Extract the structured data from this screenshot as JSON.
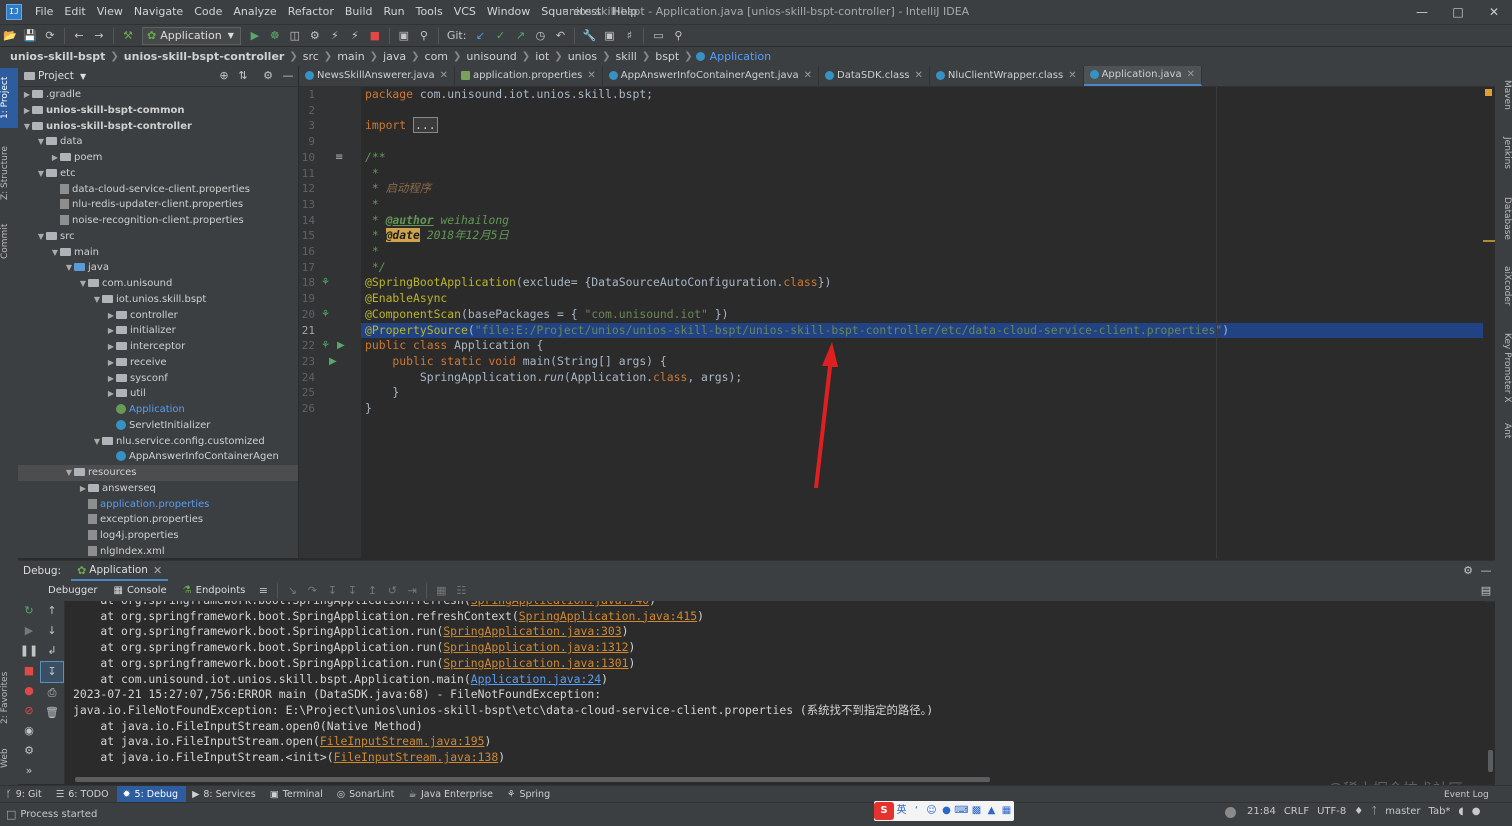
{
  "app": {
    "logo_text": "IJ",
    "window_title": "unios-skill-bspt - Application.java [unios-skill-bspt-controller] - IntelliJ IDEA"
  },
  "menu": [
    "File",
    "Edit",
    "View",
    "Navigate",
    "Code",
    "Analyze",
    "Refactor",
    "Build",
    "Run",
    "Tools",
    "VCS",
    "Window",
    "Squaretest",
    "Help"
  ],
  "toolbar": {
    "run_config": "Application",
    "git_label": "Git:"
  },
  "breadcrumb": [
    "unios-skill-bspt",
    "unios-skill-bspt-controller",
    "src",
    "main",
    "java",
    "com",
    "unisound",
    "iot",
    "unios",
    "skill",
    "bspt",
    "Application"
  ],
  "left_stripe": {
    "project": "1: Project",
    "structure": "Z: Structure",
    "commit": "Commit",
    "favorites": "2: Favorites",
    "web": "Web"
  },
  "right_stripe": [
    "Maven",
    "Jenkins",
    "Database",
    "aiXcoder",
    "Key Promoter X",
    "Ant"
  ],
  "project_panel": {
    "title": "Project",
    "tree": [
      {
        "label": ".gradle",
        "depth": 0,
        "type": "folder",
        "arrow": "right"
      },
      {
        "label": "unios-skill-bspt-common",
        "depth": 0,
        "type": "folder",
        "arrow": "right",
        "bold": true
      },
      {
        "label": "unios-skill-bspt-controller",
        "depth": 0,
        "type": "folder",
        "arrow": "down",
        "bold": true
      },
      {
        "label": "data",
        "depth": 1,
        "type": "folder",
        "arrow": "down"
      },
      {
        "label": "poem",
        "depth": 2,
        "type": "folder",
        "arrow": "right"
      },
      {
        "label": "etc",
        "depth": 1,
        "type": "folder",
        "arrow": "down"
      },
      {
        "label": "data-cloud-service-client.properties",
        "depth": 2,
        "type": "props"
      },
      {
        "label": "nlu-redis-updater-client.properties",
        "depth": 2,
        "type": "props"
      },
      {
        "label": "noise-recognition-client.properties",
        "depth": 2,
        "type": "props"
      },
      {
        "label": "src",
        "depth": 1,
        "type": "folder",
        "arrow": "down"
      },
      {
        "label": "main",
        "depth": 2,
        "type": "folder",
        "arrow": "down"
      },
      {
        "label": "java",
        "depth": 3,
        "type": "folder-blue",
        "arrow": "down"
      },
      {
        "label": "com.unisound",
        "depth": 4,
        "type": "folder",
        "arrow": "down"
      },
      {
        "label": "iot.unios.skill.bspt",
        "depth": 5,
        "type": "folder",
        "arrow": "down"
      },
      {
        "label": "controller",
        "depth": 6,
        "type": "folder",
        "arrow": "right"
      },
      {
        "label": "initializer",
        "depth": 6,
        "type": "folder",
        "arrow": "right"
      },
      {
        "label": "interceptor",
        "depth": 6,
        "type": "folder",
        "arrow": "right"
      },
      {
        "label": "receive",
        "depth": 6,
        "type": "folder",
        "arrow": "right"
      },
      {
        "label": "sysconf",
        "depth": 6,
        "type": "folder",
        "arrow": "right"
      },
      {
        "label": "util",
        "depth": 6,
        "type": "folder",
        "arrow": "right"
      },
      {
        "label": "Application",
        "depth": 6,
        "type": "class-spring",
        "blue": true
      },
      {
        "label": "ServletInitializer",
        "depth": 6,
        "type": "class"
      },
      {
        "label": "nlu.service.config.customized",
        "depth": 5,
        "type": "folder",
        "arrow": "down"
      },
      {
        "label": "AppAnswerInfoContainerAgen",
        "depth": 6,
        "type": "class"
      },
      {
        "label": "resources",
        "depth": 3,
        "type": "folder",
        "arrow": "down",
        "selected": true
      },
      {
        "label": "answerseq",
        "depth": 4,
        "type": "folder",
        "arrow": "right"
      },
      {
        "label": "application.properties",
        "depth": 4,
        "type": "props",
        "blue": true
      },
      {
        "label": "exception.properties",
        "depth": 4,
        "type": "props"
      },
      {
        "label": "log4j.properties",
        "depth": 4,
        "type": "props"
      },
      {
        "label": "nlgIndex.xml",
        "depth": 4,
        "type": "props"
      }
    ]
  },
  "editor_tabs": [
    {
      "label": "NewsSkillAnswerer.java",
      "icon": "class",
      "active": false
    },
    {
      "label": "application.properties",
      "icon": "prop",
      "active": false
    },
    {
      "label": "AppAnswerInfoContainerAgent.java",
      "icon": "class",
      "active": false
    },
    {
      "label": "DataSDK.class",
      "icon": "class",
      "active": false
    },
    {
      "label": "NluClientWrapper.class",
      "icon": "class",
      "active": false
    },
    {
      "label": "Application.java",
      "icon": "class",
      "active": true
    }
  ],
  "editor": {
    "line_numbers": [
      "1",
      "2",
      "3",
      "9",
      "10",
      "11",
      "12",
      "13",
      "14",
      "15",
      "16",
      "17",
      "18",
      "19",
      "20",
      "21",
      "22",
      "23",
      "24",
      "25",
      "26"
    ],
    "current_line": "21",
    "code": {
      "l1_kw": "package",
      "l1_rest": " com.unisound.iot.unios.skill.bspt;",
      "l3_kw": "import",
      "l3_fold": "...",
      "l10": "/**",
      "l11": " *",
      "l12_pre": " * ",
      "l12_text": "启动程序",
      "l13": " *",
      "l14_pre": " * ",
      "l14_tag": "@author",
      "l14_text": " weihailong",
      "l15_pre": " * ",
      "l15_tag": "@date",
      "l15_text": " 2018年12月5日",
      "l16": " *",
      "l17": " */",
      "l18_ann": "@SpringBootApplication",
      "l18_a": "(exclude= {DataSourceAutoConfiguration.",
      "l18_kw": "class",
      "l18_b": "})",
      "l19_ann": "@EnableAsync",
      "l20_ann": "@ComponentScan",
      "l20_a": "(basePackages = { ",
      "l20_str": "\"com.unisound.iot\"",
      "l20_b": " })",
      "l21_ann": "@PropertySource",
      "l21_a": "(",
      "l21_str": "\"file:E:/Project/unios/unios-skill-bspt/unios-skill-bspt-controller/etc/data-cloud-service-client.properties\"",
      "l21_b": ")",
      "l22_kw": "public class",
      "l22_rest": " Application {",
      "l23_kw": "    public static void",
      "l23_rest": " main(String[] args) {",
      "l24_a": "        SpringApplication.",
      "l24_it": "run",
      "l24_b": "(Application.",
      "l24_kw": "class",
      "l24_c": ", args);",
      "l25": "    }",
      "l26": "}"
    }
  },
  "debug": {
    "label": "Debug:",
    "session_tab": "Application",
    "tabs": [
      "Debugger",
      "Console",
      "Endpoints"
    ],
    "console": [
      {
        "pre": "    at org.springframework.boot.SpringApplication.refresh(",
        "link": "SpringApplication.java:740",
        "post": ")"
      },
      {
        "pre": "    at org.springframework.boot.SpringApplication.refreshContext(",
        "link": "SpringApplication.java:415",
        "post": ")"
      },
      {
        "pre": "    at org.springframework.boot.SpringApplication.run(",
        "link": "SpringApplication.java:303",
        "post": ")"
      },
      {
        "pre": "    at org.springframework.boot.SpringApplication.run(",
        "link": "SpringApplication.java:1312",
        "post": ")"
      },
      {
        "pre": "    at org.springframework.boot.SpringApplication.run(",
        "link": "SpringApplication.java:1301",
        "post": ")"
      },
      {
        "pre": "    at com.unisound.iot.unios.skill.bspt.Application.main(",
        "link": "Application.java:24",
        "post": ")",
        "blue": true
      },
      {
        "pre": "2023-07-21 15:27:07,756:ERROR main (DataSDK.java:68) - FileNotFoundException:",
        "link": "",
        "post": ""
      },
      {
        "pre": "java.io.FileNotFoundException: E:\\Project\\unios\\unios-skill-bspt\\etc\\data-cloud-service-client.properties (系统找不到指定的路径。)",
        "link": "",
        "post": ""
      },
      {
        "pre": "    at java.io.FileInputStream.open0(Native Method)",
        "link": "",
        "post": ""
      },
      {
        "pre": "    at java.io.FileInputStream.open(",
        "link": "FileInputStream.java:195",
        "post": ")"
      },
      {
        "pre": "    at java.io.FileInputStream.<init>(",
        "link": "FileInputStream.java:138",
        "post": ")"
      }
    ]
  },
  "tool_windows": [
    {
      "label": "9: Git",
      "active": false
    },
    {
      "label": "6: TODO",
      "active": false
    },
    {
      "label": "5: Debug",
      "active": true
    },
    {
      "label": "8: Services",
      "active": false
    },
    {
      "label": "Terminal",
      "active": false
    },
    {
      "label": "SonarLint",
      "active": false
    },
    {
      "label": "Java Enterprise",
      "active": false
    },
    {
      "label": "Spring",
      "active": false
    }
  ],
  "status_bar": {
    "message": "Process started",
    "position": "21:84",
    "line_sep": "CRLF",
    "encoding": "UTF-8",
    "branch": "master",
    "indent": "Tab*",
    "event_log": "Event Log"
  },
  "ime": {
    "lang": "英"
  },
  "watermark": "@稀土掘金技术社区",
  "colors": {
    "accent": "#4a88c7",
    "annotation": "#bbb529",
    "string": "#6a8759",
    "keyword": "#cc7832",
    "error_arrow": "#e02020"
  }
}
